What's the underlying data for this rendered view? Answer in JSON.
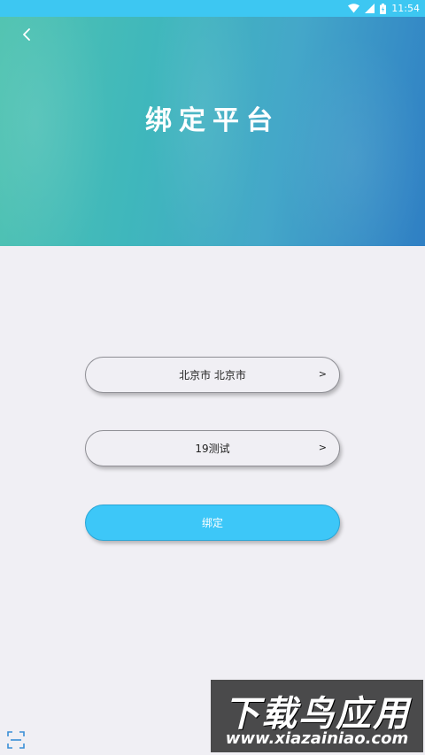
{
  "status_bar": {
    "time": "11:54"
  },
  "header": {
    "title": "绑定平台"
  },
  "form": {
    "city_selector": {
      "label": "北京市 北京市",
      "arrow": ">"
    },
    "platform_selector": {
      "label": "19测试",
      "arrow": ">"
    },
    "bind_label": "绑定"
  },
  "watermark": {
    "line1": "下载鸟应用",
    "line2": "www.xiazainiao.com"
  },
  "colors": {
    "status_bar": "#3dc7f2",
    "bind_button": "#3dc7f8",
    "background": "#f0eff4"
  }
}
